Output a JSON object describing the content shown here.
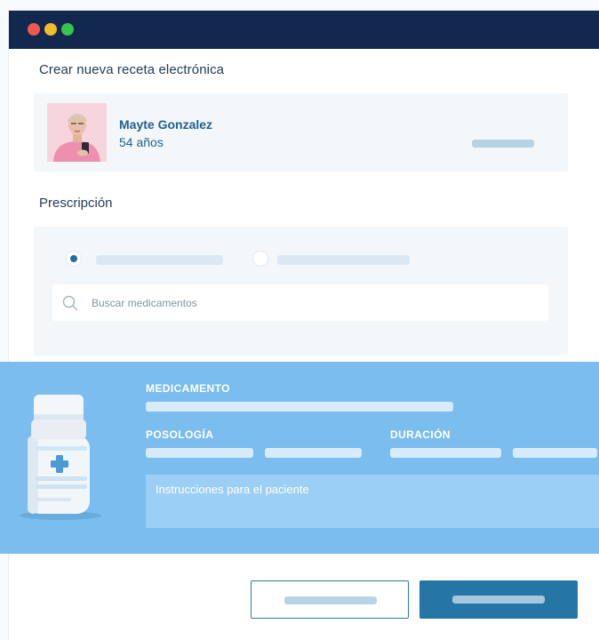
{
  "window": {
    "title_bar_color": "#12284f",
    "controls": [
      "close",
      "minimize",
      "maximize"
    ]
  },
  "page": {
    "title": "Crear nueva receta electrónica"
  },
  "patient": {
    "name": "Mayte Gonzalez",
    "age": "54 años",
    "avatar_icon": "patient-photo"
  },
  "prescription": {
    "title": "Prescripción",
    "selected_option_index": 0,
    "search": {
      "placeholder": "Buscar medicamentos",
      "value": "",
      "icon": "search-icon"
    }
  },
  "medication_card": {
    "medication_label": "MEDICAMENTO",
    "dosage_label": "POSOLOGÍA",
    "duration_label": "DURACIÓN",
    "instructions_placeholder": "Instrucciones para el paciente",
    "image_icon": "medicine-bottle-icon",
    "background_color": "#7cbdef"
  },
  "colors": {
    "accent": "#2575a5",
    "navy": "#12284f",
    "panel": "#f3f7fa"
  }
}
